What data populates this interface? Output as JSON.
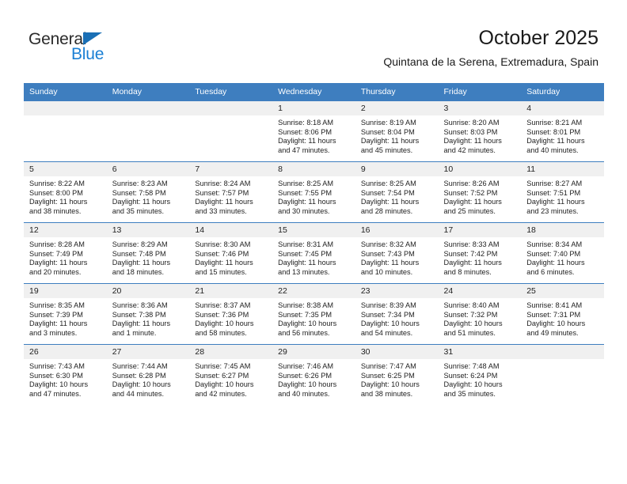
{
  "brand": {
    "name_part1": "General",
    "name_part2": "Blue",
    "accent_color": "#1a7fd4",
    "triangle_color": "#1a6fb5"
  },
  "header": {
    "title": "October 2025",
    "subtitle": "Quintana de la Serena, Extremadura, Spain"
  },
  "calendar": {
    "header_background": "#3e7ebf",
    "daynum_background": "#f0f0f0",
    "weekday_headers": [
      "Sunday",
      "Monday",
      "Tuesday",
      "Wednesday",
      "Thursday",
      "Friday",
      "Saturday"
    ],
    "weeks": [
      [
        {
          "day": "",
          "sunrise": "",
          "sunset": "",
          "daylight_line1": "",
          "daylight_line2": ""
        },
        {
          "day": "",
          "sunrise": "",
          "sunset": "",
          "daylight_line1": "",
          "daylight_line2": ""
        },
        {
          "day": "",
          "sunrise": "",
          "sunset": "",
          "daylight_line1": "",
          "daylight_line2": ""
        },
        {
          "day": "1",
          "sunrise": "Sunrise: 8:18 AM",
          "sunset": "Sunset: 8:06 PM",
          "daylight_line1": "Daylight: 11 hours",
          "daylight_line2": "and 47 minutes."
        },
        {
          "day": "2",
          "sunrise": "Sunrise: 8:19 AM",
          "sunset": "Sunset: 8:04 PM",
          "daylight_line1": "Daylight: 11 hours",
          "daylight_line2": "and 45 minutes."
        },
        {
          "day": "3",
          "sunrise": "Sunrise: 8:20 AM",
          "sunset": "Sunset: 8:03 PM",
          "daylight_line1": "Daylight: 11 hours",
          "daylight_line2": "and 42 minutes."
        },
        {
          "day": "4",
          "sunrise": "Sunrise: 8:21 AM",
          "sunset": "Sunset: 8:01 PM",
          "daylight_line1": "Daylight: 11 hours",
          "daylight_line2": "and 40 minutes."
        }
      ],
      [
        {
          "day": "5",
          "sunrise": "Sunrise: 8:22 AM",
          "sunset": "Sunset: 8:00 PM",
          "daylight_line1": "Daylight: 11 hours",
          "daylight_line2": "and 38 minutes."
        },
        {
          "day": "6",
          "sunrise": "Sunrise: 8:23 AM",
          "sunset": "Sunset: 7:58 PM",
          "daylight_line1": "Daylight: 11 hours",
          "daylight_line2": "and 35 minutes."
        },
        {
          "day": "7",
          "sunrise": "Sunrise: 8:24 AM",
          "sunset": "Sunset: 7:57 PM",
          "daylight_line1": "Daylight: 11 hours",
          "daylight_line2": "and 33 minutes."
        },
        {
          "day": "8",
          "sunrise": "Sunrise: 8:25 AM",
          "sunset": "Sunset: 7:55 PM",
          "daylight_line1": "Daylight: 11 hours",
          "daylight_line2": "and 30 minutes."
        },
        {
          "day": "9",
          "sunrise": "Sunrise: 8:25 AM",
          "sunset": "Sunset: 7:54 PM",
          "daylight_line1": "Daylight: 11 hours",
          "daylight_line2": "and 28 minutes."
        },
        {
          "day": "10",
          "sunrise": "Sunrise: 8:26 AM",
          "sunset": "Sunset: 7:52 PM",
          "daylight_line1": "Daylight: 11 hours",
          "daylight_line2": "and 25 minutes."
        },
        {
          "day": "11",
          "sunrise": "Sunrise: 8:27 AM",
          "sunset": "Sunset: 7:51 PM",
          "daylight_line1": "Daylight: 11 hours",
          "daylight_line2": "and 23 minutes."
        }
      ],
      [
        {
          "day": "12",
          "sunrise": "Sunrise: 8:28 AM",
          "sunset": "Sunset: 7:49 PM",
          "daylight_line1": "Daylight: 11 hours",
          "daylight_line2": "and 20 minutes."
        },
        {
          "day": "13",
          "sunrise": "Sunrise: 8:29 AM",
          "sunset": "Sunset: 7:48 PM",
          "daylight_line1": "Daylight: 11 hours",
          "daylight_line2": "and 18 minutes."
        },
        {
          "day": "14",
          "sunrise": "Sunrise: 8:30 AM",
          "sunset": "Sunset: 7:46 PM",
          "daylight_line1": "Daylight: 11 hours",
          "daylight_line2": "and 15 minutes."
        },
        {
          "day": "15",
          "sunrise": "Sunrise: 8:31 AM",
          "sunset": "Sunset: 7:45 PM",
          "daylight_line1": "Daylight: 11 hours",
          "daylight_line2": "and 13 minutes."
        },
        {
          "day": "16",
          "sunrise": "Sunrise: 8:32 AM",
          "sunset": "Sunset: 7:43 PM",
          "daylight_line1": "Daylight: 11 hours",
          "daylight_line2": "and 10 minutes."
        },
        {
          "day": "17",
          "sunrise": "Sunrise: 8:33 AM",
          "sunset": "Sunset: 7:42 PM",
          "daylight_line1": "Daylight: 11 hours",
          "daylight_line2": "and 8 minutes."
        },
        {
          "day": "18",
          "sunrise": "Sunrise: 8:34 AM",
          "sunset": "Sunset: 7:40 PM",
          "daylight_line1": "Daylight: 11 hours",
          "daylight_line2": "and 6 minutes."
        }
      ],
      [
        {
          "day": "19",
          "sunrise": "Sunrise: 8:35 AM",
          "sunset": "Sunset: 7:39 PM",
          "daylight_line1": "Daylight: 11 hours",
          "daylight_line2": "and 3 minutes."
        },
        {
          "day": "20",
          "sunrise": "Sunrise: 8:36 AM",
          "sunset": "Sunset: 7:38 PM",
          "daylight_line1": "Daylight: 11 hours",
          "daylight_line2": "and 1 minute."
        },
        {
          "day": "21",
          "sunrise": "Sunrise: 8:37 AM",
          "sunset": "Sunset: 7:36 PM",
          "daylight_line1": "Daylight: 10 hours",
          "daylight_line2": "and 58 minutes."
        },
        {
          "day": "22",
          "sunrise": "Sunrise: 8:38 AM",
          "sunset": "Sunset: 7:35 PM",
          "daylight_line1": "Daylight: 10 hours",
          "daylight_line2": "and 56 minutes."
        },
        {
          "day": "23",
          "sunrise": "Sunrise: 8:39 AM",
          "sunset": "Sunset: 7:34 PM",
          "daylight_line1": "Daylight: 10 hours",
          "daylight_line2": "and 54 minutes."
        },
        {
          "day": "24",
          "sunrise": "Sunrise: 8:40 AM",
          "sunset": "Sunset: 7:32 PM",
          "daylight_line1": "Daylight: 10 hours",
          "daylight_line2": "and 51 minutes."
        },
        {
          "day": "25",
          "sunrise": "Sunrise: 8:41 AM",
          "sunset": "Sunset: 7:31 PM",
          "daylight_line1": "Daylight: 10 hours",
          "daylight_line2": "and 49 minutes."
        }
      ],
      [
        {
          "day": "26",
          "sunrise": "Sunrise: 7:43 AM",
          "sunset": "Sunset: 6:30 PM",
          "daylight_line1": "Daylight: 10 hours",
          "daylight_line2": "and 47 minutes."
        },
        {
          "day": "27",
          "sunrise": "Sunrise: 7:44 AM",
          "sunset": "Sunset: 6:28 PM",
          "daylight_line1": "Daylight: 10 hours",
          "daylight_line2": "and 44 minutes."
        },
        {
          "day": "28",
          "sunrise": "Sunrise: 7:45 AM",
          "sunset": "Sunset: 6:27 PM",
          "daylight_line1": "Daylight: 10 hours",
          "daylight_line2": "and 42 minutes."
        },
        {
          "day": "29",
          "sunrise": "Sunrise: 7:46 AM",
          "sunset": "Sunset: 6:26 PM",
          "daylight_line1": "Daylight: 10 hours",
          "daylight_line2": "and 40 minutes."
        },
        {
          "day": "30",
          "sunrise": "Sunrise: 7:47 AM",
          "sunset": "Sunset: 6:25 PM",
          "daylight_line1": "Daylight: 10 hours",
          "daylight_line2": "and 38 minutes."
        },
        {
          "day": "31",
          "sunrise": "Sunrise: 7:48 AM",
          "sunset": "Sunset: 6:24 PM",
          "daylight_line1": "Daylight: 10 hours",
          "daylight_line2": "and 35 minutes."
        },
        {
          "day": "",
          "sunrise": "",
          "sunset": "",
          "daylight_line1": "",
          "daylight_line2": ""
        }
      ]
    ]
  }
}
